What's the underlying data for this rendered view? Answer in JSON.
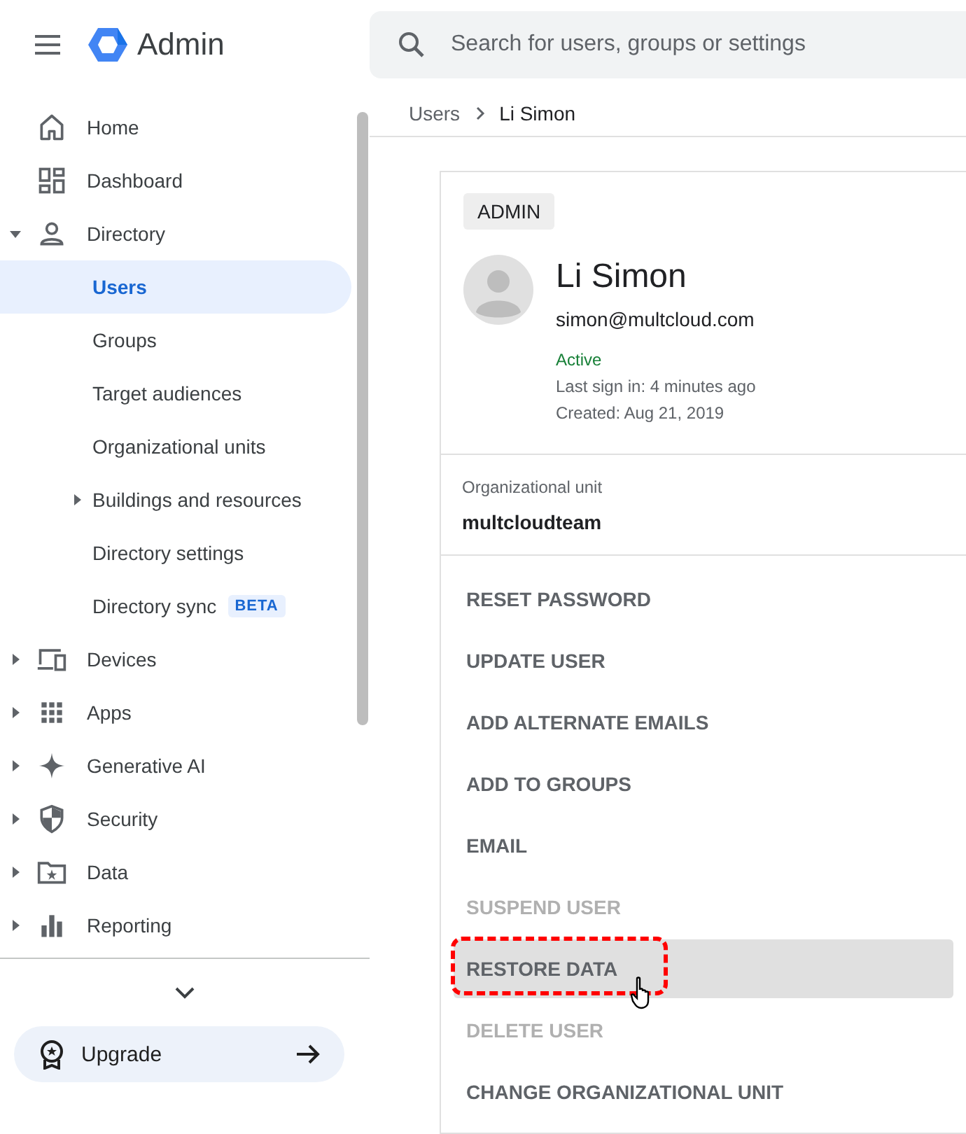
{
  "app": {
    "title": "Admin"
  },
  "search": {
    "placeholder": "Search for users, groups or settings"
  },
  "nav": [
    {
      "label": "Home",
      "selected": false
    },
    {
      "label": "Dashboard",
      "selected": false
    },
    {
      "label": "Directory",
      "selected": false,
      "expanded": true,
      "children": [
        {
          "label": "Users",
          "selected": true
        },
        {
          "label": "Groups",
          "selected": false
        },
        {
          "label": "Target audiences",
          "selected": false
        },
        {
          "label": "Organizational units",
          "selected": false
        },
        {
          "label": "Buildings and resources",
          "selected": false,
          "expanded": false
        },
        {
          "label": "Directory settings",
          "selected": false
        },
        {
          "label": "Directory sync",
          "selected": false,
          "badge": "BETA"
        }
      ]
    },
    {
      "label": "Devices",
      "selected": false,
      "expanded": false
    },
    {
      "label": "Apps",
      "selected": false,
      "expanded": false
    },
    {
      "label": "Generative AI",
      "selected": false,
      "expanded": false
    },
    {
      "label": "Security",
      "selected": false,
      "expanded": false
    },
    {
      "label": "Data",
      "selected": false,
      "expanded": false
    },
    {
      "label": "Reporting",
      "selected": false,
      "expanded": false
    }
  ],
  "upgrade": {
    "label": "Upgrade"
  },
  "breadcrumb": [
    "Users",
    "Li Simon"
  ],
  "user": {
    "role": "ADMIN",
    "name": "Li Simon",
    "email": "simon@multcloud.com",
    "status": "Active",
    "last_sign_in": "Last sign in: 4 minutes ago",
    "created": "Created: Aug 21, 2019"
  },
  "org_unit": {
    "label": "Organizational unit",
    "value": "multcloudteam"
  },
  "actions": [
    {
      "label": "RESET PASSWORD",
      "disabled": false,
      "hovered": false
    },
    {
      "label": "UPDATE USER",
      "disabled": false,
      "hovered": false
    },
    {
      "label": "ADD ALTERNATE EMAILS",
      "disabled": false,
      "hovered": false
    },
    {
      "label": "ADD TO GROUPS",
      "disabled": false,
      "hovered": false
    },
    {
      "label": "EMAIL",
      "disabled": false,
      "hovered": false
    },
    {
      "label": "SUSPEND USER",
      "disabled": true,
      "hovered": false
    },
    {
      "label": "RESTORE DATA",
      "disabled": false,
      "hovered": true
    },
    {
      "label": "DELETE USER",
      "disabled": true,
      "hovered": false
    },
    {
      "label": "CHANGE ORGANIZATIONAL UNIT",
      "disabled": false,
      "hovered": false
    }
  ]
}
